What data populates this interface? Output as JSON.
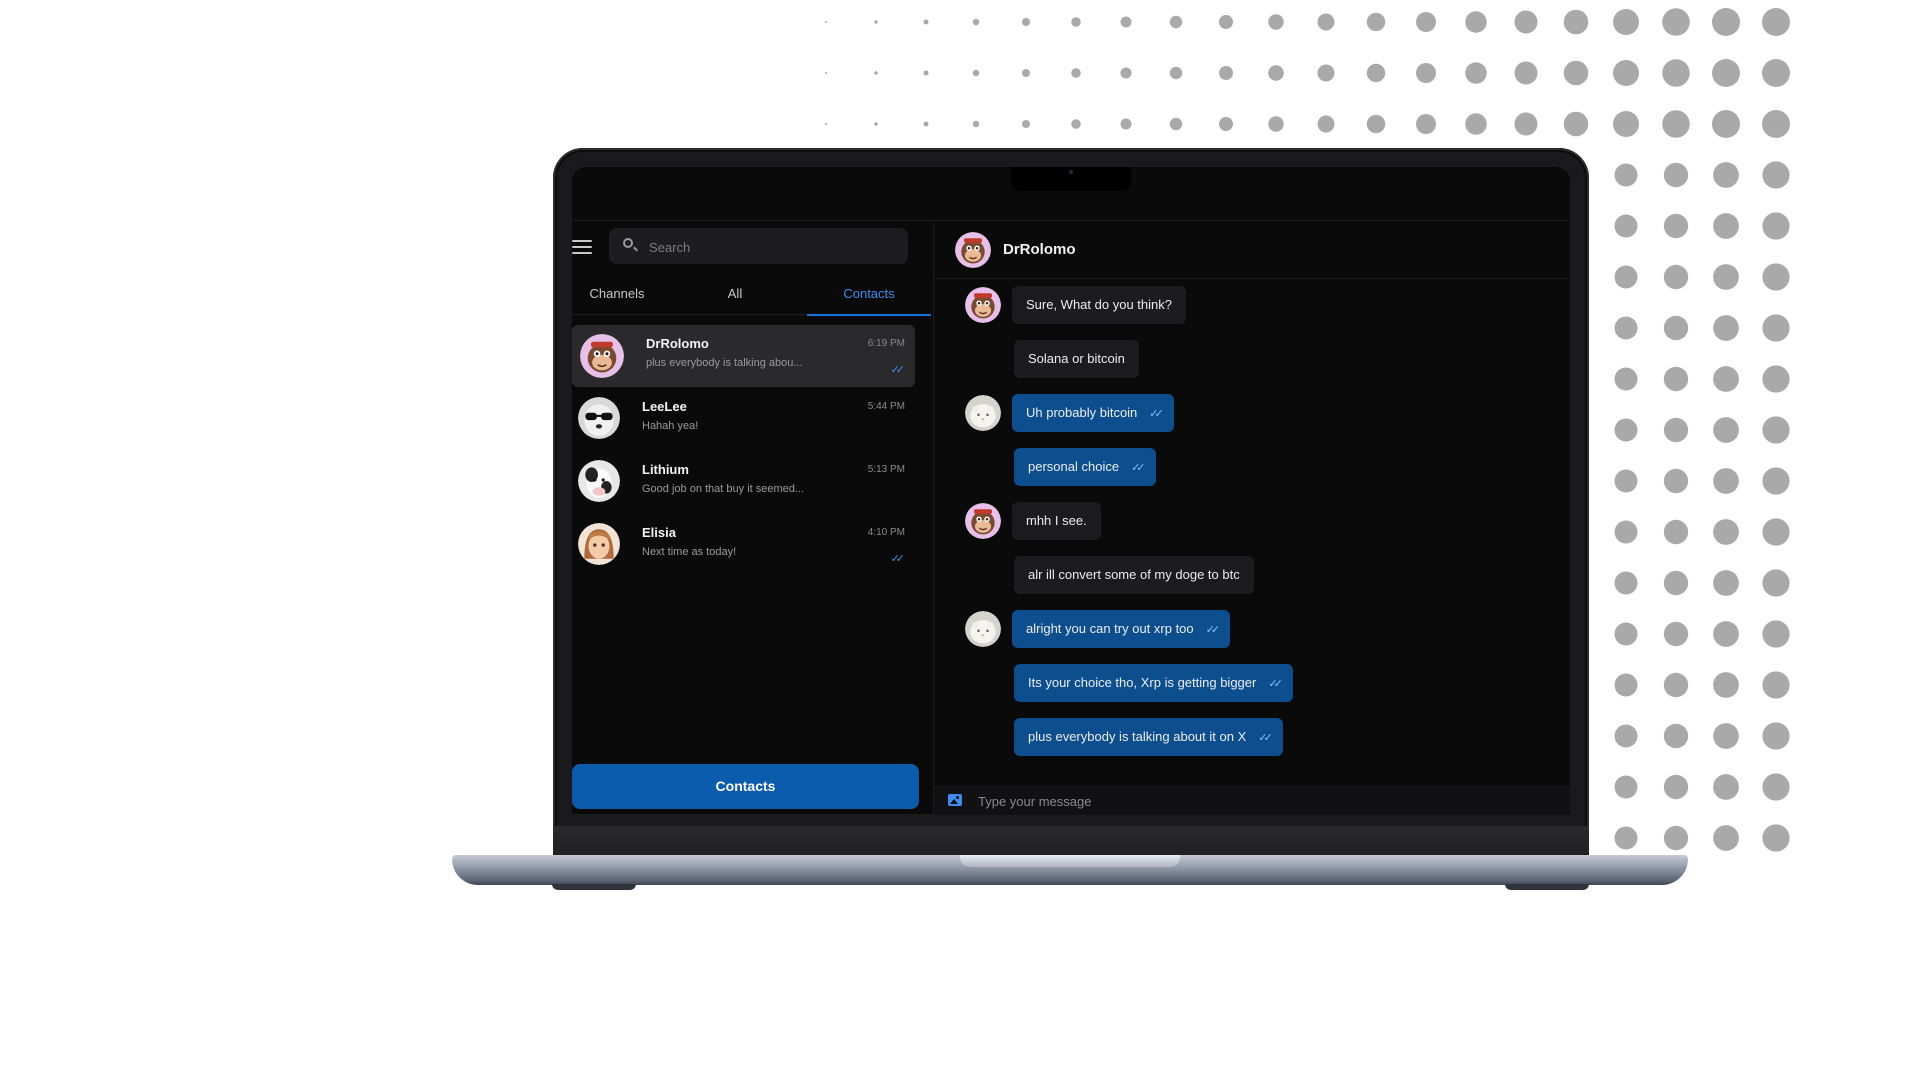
{
  "app": {
    "search": {
      "placeholder": "Search"
    },
    "tabs": [
      {
        "label": "Channels",
        "active": false
      },
      {
        "label": "All",
        "active": false
      },
      {
        "label": "Contacts",
        "active": true
      }
    ],
    "contacts": [
      {
        "name": "DrRolomo",
        "preview": "plus everybody is talking abou...",
        "time": "6:19 PM",
        "read": true,
        "selected": true,
        "avatar": "monkey-avatar"
      },
      {
        "name": "LeeLee",
        "preview": "Hahah yea!",
        "time": "5:44 PM",
        "read": false,
        "selected": false,
        "avatar": "dog-sunglasses-avatar"
      },
      {
        "name": "Lithium",
        "preview": "Good job on that buy it seemed...",
        "time": "5:13 PM",
        "read": false,
        "selected": false,
        "avatar": "cow-avatar"
      },
      {
        "name": "Elisia",
        "preview": "Next time as today!",
        "time": "4:10 PM",
        "read": true,
        "selected": false,
        "avatar": "girl-avatar"
      }
    ],
    "contacts_button": "Contacts",
    "chat": {
      "name": "DrRolomo",
      "messages": [
        {
          "text": "Sure, What do you think?",
          "direction": "in",
          "avatar": "monkey-avatar"
        },
        {
          "text": "Solana or bitcoin",
          "direction": "in"
        },
        {
          "text": "Uh probably bitcoin",
          "direction": "out",
          "avatar": "cat-avatar",
          "read": true
        },
        {
          "text": "personal choice",
          "direction": "out",
          "read": true
        },
        {
          "text": "mhh I see.",
          "direction": "in",
          "avatar": "monkey-avatar"
        },
        {
          "text": "alr ill convert some of my doge to btc",
          "direction": "in"
        },
        {
          "text": "alright you can try out xrp too",
          "direction": "out",
          "avatar": "cat-avatar",
          "read": true
        },
        {
          "text": "Its your choice tho, Xrp is getting bigger",
          "direction": "out",
          "read": true
        },
        {
          "text": "plus everybody is talking about it on X",
          "direction": "out",
          "read": true
        }
      ]
    },
    "message_input": {
      "placeholder": "Type your message"
    },
    "colors": {
      "accent": "#1a72d8",
      "outgoing_bubble": "#0d4e8e",
      "incoming_bubble": "#1c1c1e",
      "background": "#0a0a0a"
    }
  }
}
